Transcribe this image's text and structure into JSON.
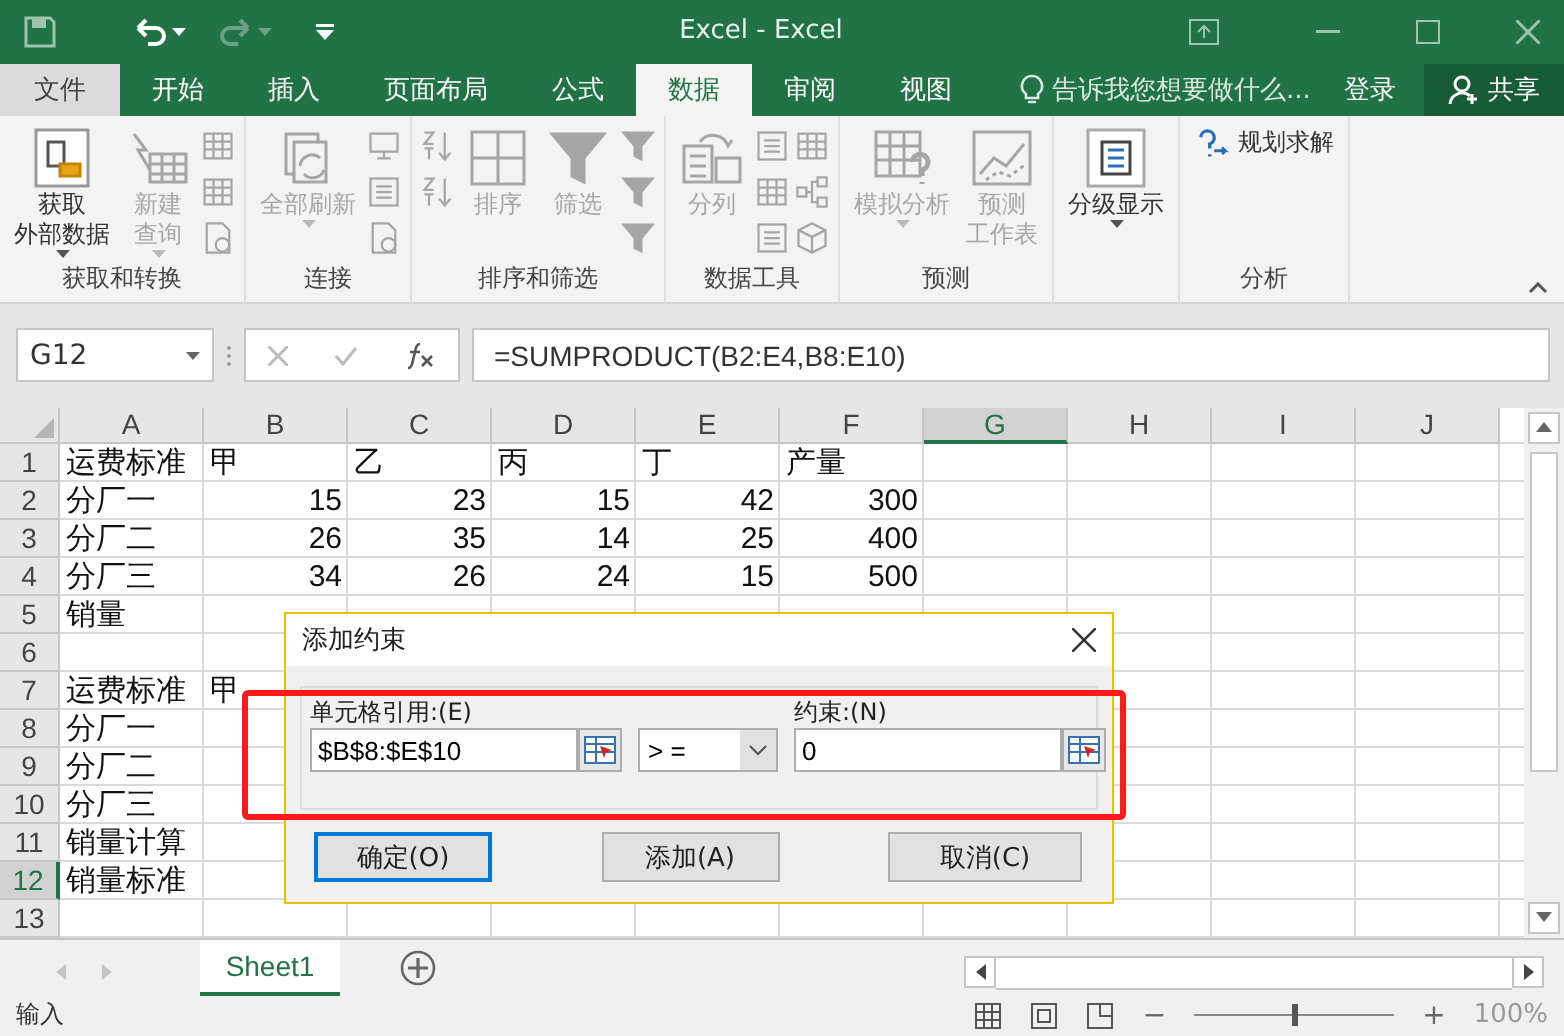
{
  "window": {
    "title": "Excel - Excel"
  },
  "tabs": [
    {
      "label": "文件",
      "kind": "file"
    },
    {
      "label": "开始",
      "kind": "tab",
      "selected": false
    },
    {
      "label": "插入",
      "kind": "tab",
      "selected": false
    },
    {
      "label": "页面布局",
      "kind": "tab",
      "selected": false
    },
    {
      "label": "公式",
      "kind": "tab",
      "selected": false
    },
    {
      "label": "数据",
      "kind": "tab",
      "selected": true
    },
    {
      "label": "审阅",
      "kind": "tab",
      "selected": false
    },
    {
      "label": "视图",
      "kind": "tab",
      "selected": false
    }
  ],
  "tell_me": {
    "placeholder": "告诉我您想要做什么..."
  },
  "account": {
    "login": "登录",
    "share": "共享"
  },
  "ribbon": [
    {
      "label": "获取和转换",
      "items": [
        {
          "kind": "large",
          "lines": [
            "获取",
            "外部数据"
          ],
          "disabled": false,
          "dropdown": true
        },
        {
          "kind": "large",
          "lines": [
            "新建",
            "查询"
          ],
          "disabled": true,
          "dropdown": true
        },
        {
          "kind": "stack",
          "icons": [
            {
              "disabled": true
            },
            {
              "disabled": true
            },
            {
              "disabled": true
            }
          ]
        }
      ]
    },
    {
      "label": "连接",
      "items": [
        {
          "kind": "large",
          "lines": [
            "全部刷新"
          ],
          "disabled": true,
          "dropdown": true
        },
        {
          "kind": "stack",
          "icons": [
            {
              "disabled": true
            },
            {
              "disabled": true
            },
            {
              "disabled": true
            }
          ]
        }
      ]
    },
    {
      "label": "排序和筛选",
      "items": [
        {
          "kind": "stack",
          "icons": [
            {
              "disabled": true
            },
            {
              "disabled": true
            }
          ]
        },
        {
          "kind": "large",
          "lines": [
            "排序"
          ],
          "disabled": true,
          "dropdown": false
        },
        {
          "kind": "large",
          "lines": [
            "筛选"
          ],
          "disabled": true,
          "dropdown": false
        },
        {
          "kind": "stack",
          "icons": [
            {
              "disabled": true
            },
            {
              "disabled": true
            },
            {
              "disabled": true
            }
          ]
        }
      ]
    },
    {
      "label": "数据工具",
      "items": [
        {
          "kind": "large",
          "lines": [
            "分列"
          ],
          "disabled": true,
          "dropdown": false
        },
        {
          "kind": "stack",
          "icons": [
            {
              "disabled": true
            },
            {
              "disabled": true
            },
            {
              "disabled": true
            }
          ]
        },
        {
          "kind": "stack",
          "icons": [
            {
              "disabled": true
            },
            {
              "disabled": true
            },
            {
              "disabled": true
            }
          ]
        }
      ]
    },
    {
      "label": "预测",
      "items": [
        {
          "kind": "large",
          "lines": [
            "模拟分析"
          ],
          "disabled": true,
          "dropdown": true
        },
        {
          "kind": "large",
          "lines": [
            "预测",
            "工作表"
          ],
          "disabled": true,
          "dropdown": false
        }
      ]
    },
    {
      "items": [
        {
          "kind": "large",
          "lines": [
            "分级显示"
          ],
          "disabled": false,
          "dropdown": true
        }
      ]
    },
    {
      "label": "分析",
      "items": [
        {
          "kind": "inline",
          "lines": [
            "规划求解"
          ],
          "disabled": false,
          "dropdown": false
        }
      ]
    }
  ],
  "formula_bar": {
    "name_box": "G12",
    "formula": "=SUMPRODUCT(B2:E4,B8:E10)"
  },
  "columns": [
    {
      "label": "A",
      "selected": false
    },
    {
      "label": "B",
      "selected": false
    },
    {
      "label": "C",
      "selected": false
    },
    {
      "label": "D",
      "selected": false
    },
    {
      "label": "E",
      "selected": false
    },
    {
      "label": "F",
      "selected": false
    },
    {
      "label": "G",
      "selected": true
    },
    {
      "label": "H",
      "selected": false
    },
    {
      "label": "I",
      "selected": false
    },
    {
      "label": "J",
      "selected": false
    }
  ],
  "rows": [
    {
      "number": "1",
      "selected": false,
      "cells": [
        {
          "text": "运费标准",
          "kind": "text"
        },
        {
          "text": "甲",
          "kind": "text"
        },
        {
          "text": "乙",
          "kind": "text"
        },
        {
          "text": "丙",
          "kind": "text"
        },
        {
          "text": "丁",
          "kind": "text"
        },
        {
          "text": "产量",
          "kind": "text"
        }
      ]
    },
    {
      "number": "2",
      "selected": false,
      "cells": [
        {
          "text": "分厂一",
          "kind": "text"
        },
        {
          "text": "15",
          "kind": "number"
        },
        {
          "text": "23",
          "kind": "number"
        },
        {
          "text": "15",
          "kind": "number"
        },
        {
          "text": "42",
          "kind": "number"
        },
        {
          "text": "300",
          "kind": "number"
        }
      ]
    },
    {
      "number": "3",
      "selected": false,
      "cells": [
        {
          "text": "分厂二",
          "kind": "text"
        },
        {
          "text": "26",
          "kind": "number"
        },
        {
          "text": "35",
          "kind": "number"
        },
        {
          "text": "14",
          "kind": "number"
        },
        {
          "text": "25",
          "kind": "number"
        },
        {
          "text": "400",
          "kind": "number"
        }
      ]
    },
    {
      "number": "4",
      "selected": false,
      "cells": [
        {
          "text": "分厂三",
          "kind": "text"
        },
        {
          "text": "34",
          "kind": "number"
        },
        {
          "text": "26",
          "kind": "number"
        },
        {
          "text": "24",
          "kind": "number"
        },
        {
          "text": "15",
          "kind": "number"
        },
        {
          "text": "500",
          "kind": "number"
        }
      ]
    },
    {
      "number": "5",
      "selected": false,
      "cells": [
        {
          "text": "销量",
          "kind": "text"
        }
      ]
    },
    {
      "number": "6",
      "selected": false,
      "cells": []
    },
    {
      "number": "7",
      "selected": false,
      "cells": [
        {
          "text": "运费标准",
          "kind": "text"
        },
        {
          "text": "甲",
          "kind": "text"
        }
      ]
    },
    {
      "number": "8",
      "selected": false,
      "cells": [
        {
          "text": "分厂一",
          "kind": "text"
        }
      ]
    },
    {
      "number": "9",
      "selected": false,
      "cells": [
        {
          "text": "分厂二",
          "kind": "text"
        }
      ]
    },
    {
      "number": "10",
      "selected": false,
      "cells": [
        {
          "text": "分厂三",
          "kind": "text"
        }
      ]
    },
    {
      "number": "11",
      "selected": false,
      "cells": [
        {
          "text": "销量计算",
          "kind": "text"
        }
      ]
    },
    {
      "number": "12",
      "selected": true,
      "cells": [
        {
          "text": "销量标准",
          "kind": "text"
        }
      ]
    },
    {
      "number": "13",
      "selected": false,
      "cells": []
    }
  ],
  "dialog": {
    "title": "添加约束",
    "cell_ref_label": "单元格引用:(E)",
    "cell_ref": "$B$8:$E$10",
    "operator": "> =",
    "constraint_label": "约束:(N)",
    "constraint": "0",
    "buttons": [
      {
        "label": "确定(O)",
        "default": true
      },
      {
        "label": "添加(A)",
        "default": false
      },
      {
        "label": "取消(C)",
        "default": false
      }
    ]
  },
  "sheets": [
    {
      "label": "Sheet1",
      "selected": true
    }
  ],
  "status_bar": {
    "mode": "输入",
    "zoom_out": "−",
    "zoom_in": "+",
    "zoom_slider": {
      "level": 0.5
    },
    "zoom": "100%"
  }
}
